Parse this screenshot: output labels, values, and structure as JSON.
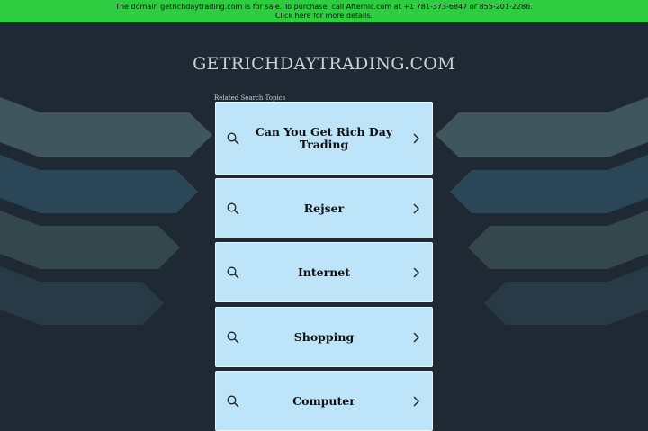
{
  "banner": {
    "text": "The domain getrichdaytrading.com is for sale. To purchase, call Afternic.com at +1 781-373-6847 or 855-201-2286. Click here for more details."
  },
  "site": {
    "title": "GETRICHDAYTRADING.COM",
    "related_label": "Related Search Topics"
  },
  "topics": [
    {
      "label": "Can You Get Rich Day Trading"
    },
    {
      "label": "Rejser"
    },
    {
      "label": "Internet"
    },
    {
      "label": "Shopping"
    },
    {
      "label": "Computer"
    }
  ],
  "icons": {
    "search": "search-icon",
    "chevron": "chevron-right-icon"
  },
  "colors": {
    "banner": "#2ecc40",
    "background": "#1f2933",
    "card": "#bde4f8",
    "stripe_teal": "#3f575c",
    "stripe_blue": "#2b4656"
  }
}
